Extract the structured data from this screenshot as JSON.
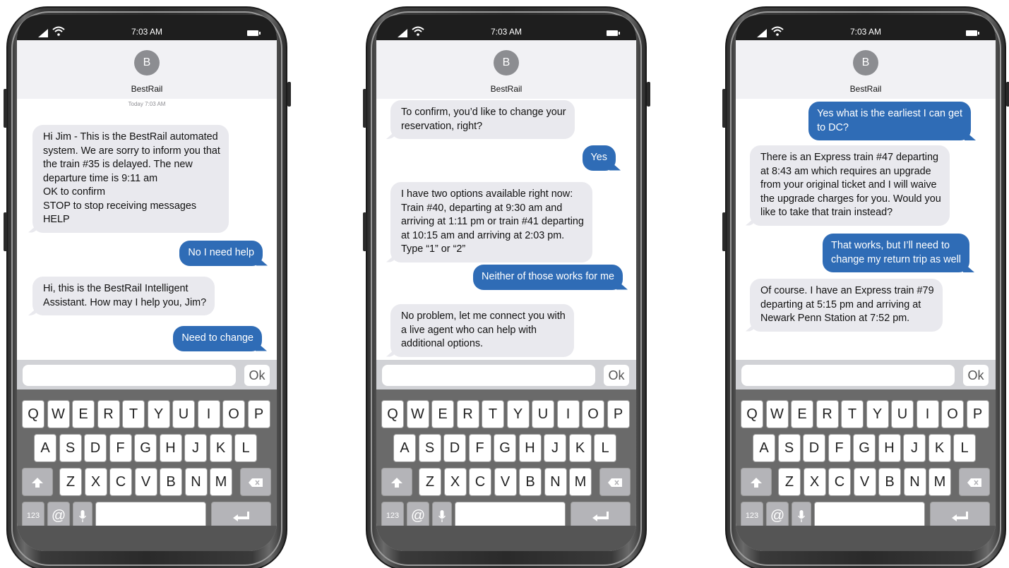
{
  "status_time": "7:03 AM",
  "contact": {
    "initial": "B",
    "name": "BestRail"
  },
  "keyboard": {
    "row1": [
      "Q",
      "W",
      "E",
      "R",
      "T",
      "Y",
      "U",
      "I",
      "O",
      "P"
    ],
    "row2": [
      "A",
      "S",
      "D",
      "F",
      "G",
      "H",
      "J",
      "K",
      "L"
    ],
    "row3": [
      "Z",
      "X",
      "C",
      "V",
      "B",
      "N",
      "M"
    ],
    "numbers_label": "123",
    "at_label": "@",
    "ok_label": "Ok"
  },
  "phones": [
    {
      "timestamp": "Today 7:03 AM",
      "messages": [
        {
          "dir": "in",
          "text": "Hi Jim - This is the BestRail automated\nsystem. We are sorry to inform you that\nthe train #35 is delayed. The new\ndeparture time is 9:11 am\nOK to confirm\nSTOP to stop receiving messages\nHELP"
        },
        {
          "dir": "out",
          "text": "No I need help"
        },
        {
          "dir": "in",
          "text": "Hi, this is the BestRail Intelligent\nAssistant. How may I help you, Jim?"
        },
        {
          "dir": "out",
          "text": "Need to change"
        }
      ]
    },
    {
      "timestamp": "",
      "messages": [
        {
          "dir": "in",
          "text": "To confirm, you’d like to change your\nreservation, right?"
        },
        {
          "dir": "out",
          "text": "Yes"
        },
        {
          "dir": "in",
          "text": "I have two options available right now:\nTrain #40, departing at 9:30 am and\narriving at 1:11 pm or train #41 departing\nat 10:15 am and arriving at 2:03 pm.\nType “1” or “2”"
        },
        {
          "dir": "out",
          "text": "Neither of those works for me"
        },
        {
          "dir": "in",
          "text": "No problem, let me connect you with\na live agent who can help with\nadditional options."
        }
      ]
    },
    {
      "timestamp": "",
      "messages": [
        {
          "dir": "out",
          "text": "Yes what is the earliest I can get\nto DC?"
        },
        {
          "dir": "in",
          "text": "There is an Express train #47 departing\nat 8:43 am which requires an upgrade\nfrom your original ticket and I will waive\nthe upgrade charges for you. Would you\nlike to take that train instead?"
        },
        {
          "dir": "out",
          "text": "That works, but I’ll need to\nchange my return trip as well"
        },
        {
          "dir": "in",
          "text": "Of course. I have an Express train #79\ndeparting at 5:15 pm and arriving at\nNewark Penn Station at 7:52 pm."
        }
      ]
    }
  ]
}
